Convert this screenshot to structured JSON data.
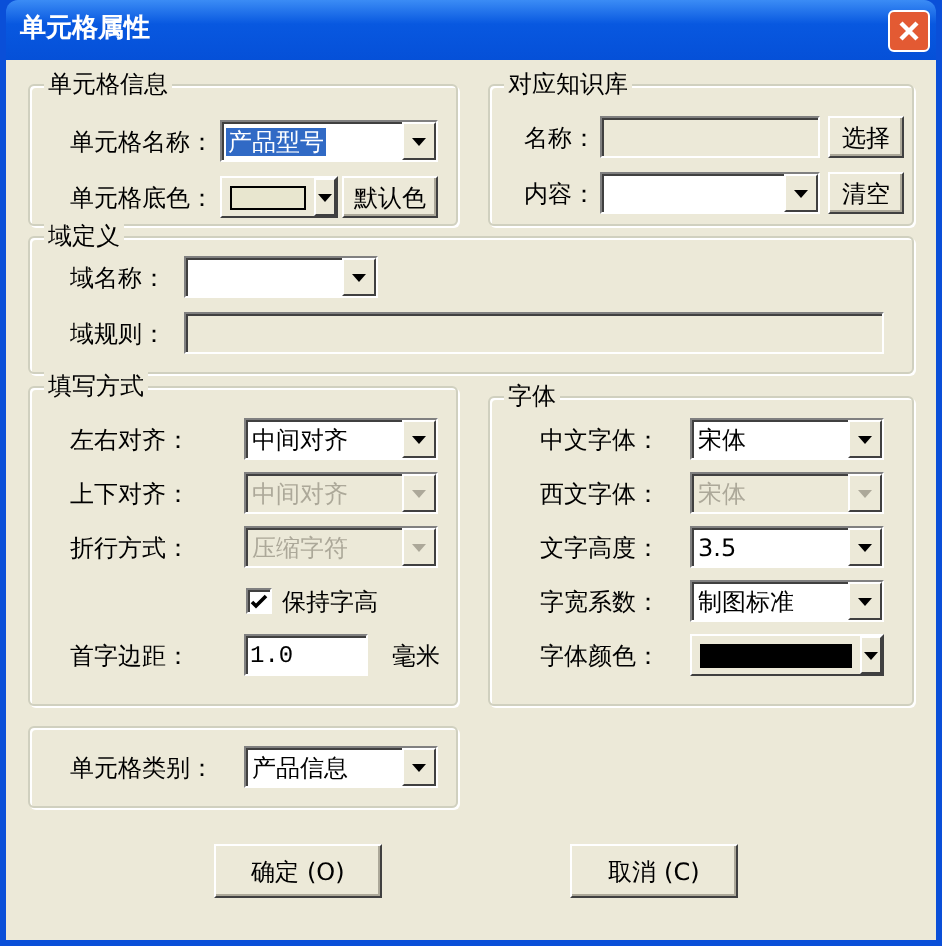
{
  "window": {
    "title": "单元格属性"
  },
  "cell_info": {
    "title": "单元格信息",
    "name": {
      "label": "单元格名称：",
      "value": "产品型号",
      "highlighted": true
    },
    "background": {
      "label": "单元格底色：",
      "color": "#e8e6cf"
    },
    "default_button": "默认色"
  },
  "knowledge_base": {
    "title": "对应知识库",
    "name": {
      "label": "名称：",
      "disabled": true
    },
    "select_button": "选择",
    "content": {
      "label": "内容："
    },
    "clear_button": "清空"
  },
  "domain": {
    "title": "域定义",
    "name": {
      "label": "域名称："
    },
    "rule": {
      "label": "域规则：",
      "disabled": true
    }
  },
  "fill_mode": {
    "title": "填写方式",
    "rows": [
      {
        "kind": "combo",
        "label": "左右对齐：",
        "value": "中间对齐",
        "disabled": false
      },
      {
        "kind": "combo",
        "label": "上下对齐：",
        "value": "中间对齐",
        "disabled": true
      },
      {
        "kind": "combo",
        "label": "折行方式：",
        "value": "压缩字符",
        "disabled": true
      },
      {
        "kind": "checkbox",
        "label": "保持字高",
        "checked": true
      },
      {
        "kind": "text",
        "label": "首字边距：",
        "value": "1.0",
        "unit": "毫米"
      }
    ]
  },
  "font": {
    "title": "字体",
    "rows": [
      {
        "kind": "combo",
        "label": "中文字体：",
        "value": "宋体",
        "disabled": false
      },
      {
        "kind": "combo",
        "label": "西文字体：",
        "value": "宋体",
        "disabled": true
      },
      {
        "kind": "combo",
        "label": "文字高度：",
        "value": "3.5",
        "disabled": false
      },
      {
        "kind": "combo",
        "label": "字宽系数：",
        "value": "制图标准",
        "disabled": false
      },
      {
        "kind": "color",
        "label": "字体颜色：",
        "color": "#000000"
      }
    ]
  },
  "category": {
    "label": "单元格类别：",
    "value": "产品信息"
  },
  "buttons": [
    {
      "label": "确定 (O)"
    },
    {
      "label": "取消 (C)"
    }
  ]
}
